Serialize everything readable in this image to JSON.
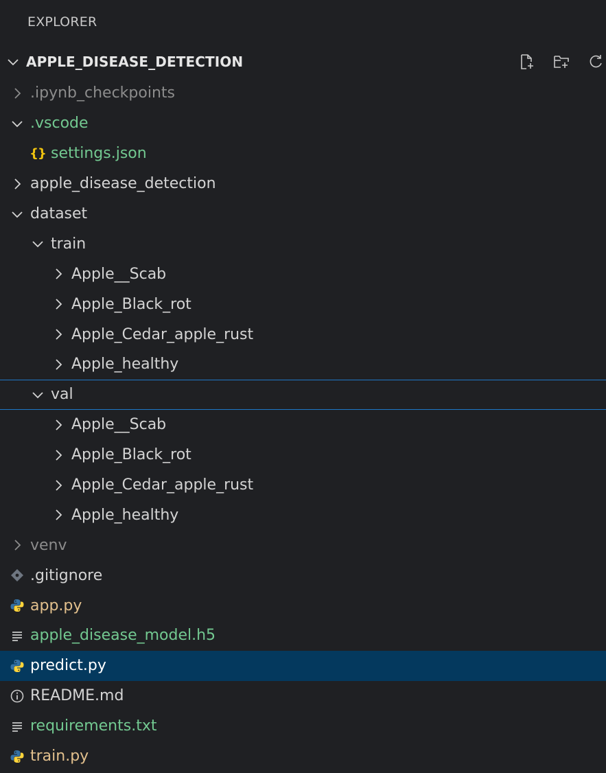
{
  "explorer": {
    "title": "EXPLORER"
  },
  "section": {
    "title": "APPLE_DISEASE_DETECTION",
    "actions": [
      "new-file-icon",
      "new-folder-icon",
      "refresh-icon"
    ]
  },
  "colors": {
    "background": "#1f2023",
    "selection": "#04395e",
    "focus_border": "#1e78c8",
    "modified_green": "#73c991",
    "untracked_yellow": "#e2c08d",
    "ignored_gray": "#8c8c8c",
    "python_blue": "#3572a5",
    "python_yellow": "#ffd43b"
  },
  "tree": [
    {
      "label": ".ipynb_checkpoints",
      "type": "folder",
      "state": "collapsed",
      "depth": 0,
      "color": "dim"
    },
    {
      "label": ".vscode",
      "type": "folder",
      "state": "expanded",
      "depth": 0,
      "color": "green"
    },
    {
      "label": "settings.json",
      "type": "file",
      "icon": "json-braces-icon",
      "depth": 1,
      "color": "green"
    },
    {
      "label": "apple_disease_detection",
      "type": "folder",
      "state": "collapsed",
      "depth": 0,
      "color": "default"
    },
    {
      "label": "dataset",
      "type": "folder",
      "state": "expanded",
      "depth": 0,
      "color": "default"
    },
    {
      "label": "train",
      "type": "folder",
      "state": "expanded",
      "depth": 1,
      "color": "default"
    },
    {
      "label": "Apple__Scab",
      "type": "folder",
      "state": "collapsed",
      "depth": 2,
      "color": "default"
    },
    {
      "label": "Apple_Black_rot",
      "type": "folder",
      "state": "collapsed",
      "depth": 2,
      "color": "default"
    },
    {
      "label": "Apple_Cedar_apple_rust",
      "type": "folder",
      "state": "collapsed",
      "depth": 2,
      "color": "default"
    },
    {
      "label": "Apple_healthy",
      "type": "folder",
      "state": "collapsed",
      "depth": 2,
      "color": "default"
    },
    {
      "label": "val",
      "type": "folder",
      "state": "expanded",
      "depth": 1,
      "color": "default",
      "focused": true
    },
    {
      "label": "Apple__Scab",
      "type": "folder",
      "state": "collapsed",
      "depth": 2,
      "color": "default"
    },
    {
      "label": "Apple_Black_rot",
      "type": "folder",
      "state": "collapsed",
      "depth": 2,
      "color": "default"
    },
    {
      "label": "Apple_Cedar_apple_rust",
      "type": "folder",
      "state": "collapsed",
      "depth": 2,
      "color": "default"
    },
    {
      "label": "Apple_healthy",
      "type": "folder",
      "state": "collapsed",
      "depth": 2,
      "color": "default"
    },
    {
      "label": "venv",
      "type": "folder",
      "state": "collapsed",
      "depth": 0,
      "color": "dim"
    },
    {
      "label": ".gitignore",
      "type": "file",
      "icon": "git-diamond-icon",
      "depth": 0,
      "color": "default"
    },
    {
      "label": "app.py",
      "type": "file",
      "icon": "python-icon",
      "depth": 0,
      "color": "yellow"
    },
    {
      "label": "apple_disease_model.h5",
      "type": "file",
      "icon": "text-lines-icon",
      "depth": 0,
      "color": "green"
    },
    {
      "label": "predict.py",
      "type": "file",
      "icon": "python-icon",
      "depth": 0,
      "color": "white",
      "selected": true
    },
    {
      "label": "README.md",
      "type": "file",
      "icon": "info-icon",
      "depth": 0,
      "color": "default"
    },
    {
      "label": "requirements.txt",
      "type": "file",
      "icon": "text-lines-icon",
      "depth": 0,
      "color": "green"
    },
    {
      "label": "train.py",
      "type": "file",
      "icon": "python-icon",
      "depth": 0,
      "color": "yellow"
    }
  ]
}
